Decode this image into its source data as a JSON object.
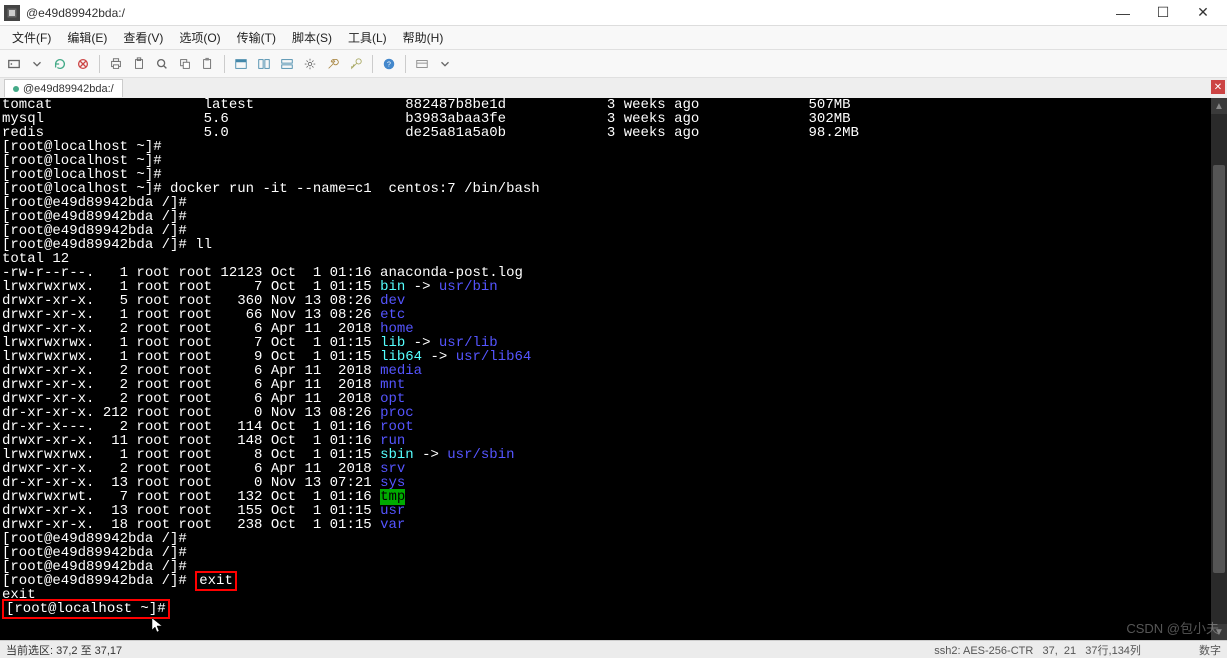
{
  "window": {
    "title": "@e49d89942bda:/",
    "minimize": "—",
    "maximize": "☐",
    "close": "✕"
  },
  "menu": {
    "file": "文件(F)",
    "edit": "编辑(E)",
    "view": "查看(V)",
    "option": "选项(O)",
    "transfer": "传输(T)",
    "script": "脚本(S)",
    "tool": "工具(L)",
    "help": "帮助(H)"
  },
  "tab": {
    "label": "@e49d89942bda:/",
    "close_all": "✕"
  },
  "terminal": {
    "images": [
      {
        "name": "tomcat",
        "tag": "latest",
        "id": "882487b8be1d",
        "created": "3 weeks ago",
        "size": "507MB"
      },
      {
        "name": "mysql",
        "tag": "5.6",
        "id": "b3983abaa3fe",
        "created": "3 weeks ago",
        "size": "302MB"
      },
      {
        "name": "redis",
        "tag": "5.0",
        "id": "de25a81a5a0b",
        "created": "3 weeks ago",
        "size": "98.2MB"
      }
    ],
    "prompt_local1": "[root@localhost ~]#",
    "prompt_local2": "[root@localhost ~]#",
    "prompt_local3": "[root@localhost ~]#",
    "cmd_docker": "[root@localhost ~]# docker run -it --name=c1  centos:7 /bin/bash",
    "prompt_ct1": "[root@e49d89942bda /]#",
    "prompt_ct2": "[root@e49d89942bda /]#",
    "prompt_ct3": "[root@e49d89942bda /]#",
    "cmd_ll": "[root@e49d89942bda /]# ll",
    "total": "total 12",
    "ls": [
      {
        "pre": "-rw-r--r--.   1 root root 12123 Oct  1 01:16 ",
        "name": "anaconda-post.log",
        "cls": ""
      },
      {
        "pre": "lrwxrwxrwx.   1 root root     7 Oct  1 01:15 ",
        "name": "bin",
        "link": " -> ",
        "target": "usr/bin",
        "cls": "c",
        "tcls": "b"
      },
      {
        "pre": "drwxr-xr-x.   5 root root   360 Nov 13 08:26 ",
        "name": "dev",
        "cls": "b"
      },
      {
        "pre": "drwxr-xr-x.   1 root root    66 Nov 13 08:26 ",
        "name": "etc",
        "cls": "b"
      },
      {
        "pre": "drwxr-xr-x.   2 root root     6 Apr 11  2018 ",
        "name": "home",
        "cls": "b"
      },
      {
        "pre": "lrwxrwxrwx.   1 root root     7 Oct  1 01:15 ",
        "name": "lib",
        "link": " -> ",
        "target": "usr/lib",
        "cls": "c",
        "tcls": "b"
      },
      {
        "pre": "lrwxrwxrwx.   1 root root     9 Oct  1 01:15 ",
        "name": "lib64",
        "link": " -> ",
        "target": "usr/lib64",
        "cls": "c",
        "tcls": "b"
      },
      {
        "pre": "drwxr-xr-x.   2 root root     6 Apr 11  2018 ",
        "name": "media",
        "cls": "b"
      },
      {
        "pre": "drwxr-xr-x.   2 root root     6 Apr 11  2018 ",
        "name": "mnt",
        "cls": "b"
      },
      {
        "pre": "drwxr-xr-x.   2 root root     6 Apr 11  2018 ",
        "name": "opt",
        "cls": "b"
      },
      {
        "pre": "dr-xr-xr-x. 212 root root     0 Nov 13 08:26 ",
        "name": "proc",
        "cls": "b"
      },
      {
        "pre": "dr-xr-x---.   2 root root   114 Oct  1 01:16 ",
        "name": "root",
        "cls": "b"
      },
      {
        "pre": "drwxr-xr-x.  11 root root   148 Oct  1 01:16 ",
        "name": "run",
        "cls": "b"
      },
      {
        "pre": "lrwxrwxrwx.   1 root root     8 Oct  1 01:15 ",
        "name": "sbin",
        "link": " -> ",
        "target": "usr/sbin",
        "cls": "c",
        "tcls": "b"
      },
      {
        "pre": "drwxr-xr-x.   2 root root     6 Apr 11  2018 ",
        "name": "srv",
        "cls": "b"
      },
      {
        "pre": "dr-xr-xr-x.  13 root root     0 Nov 13 07:21 ",
        "name": "sys",
        "cls": "b"
      },
      {
        "pre": "drwxrwxrwt.   7 root root   132 Oct  1 01:16 ",
        "name": "tmp",
        "cls": "g-bg"
      },
      {
        "pre": "drwxr-xr-x.  13 root root   155 Oct  1 01:15 ",
        "name": "usr",
        "cls": "b"
      },
      {
        "pre": "drwxr-xr-x.  18 root root   238 Oct  1 01:15 ",
        "name": "var",
        "cls": "b"
      }
    ],
    "prompt_ct4": "[root@e49d89942bda /]#",
    "prompt_ct5": "[root@e49d89942bda /]#",
    "prompt_ct6": "[root@e49d89942bda /]#",
    "prompt_exit_pre": "[root@e49d89942bda /]# ",
    "cmd_exit": "exit",
    "exit_echo": "exit",
    "prompt_back": "[root@localhost ~]#"
  },
  "status": {
    "left": "当前选区: 37,2 至 37,17",
    "right": "ssh2: AES-256-CTR   37,  21   37行,134列                   数字"
  },
  "watermark": "CSDN @包小夫"
}
